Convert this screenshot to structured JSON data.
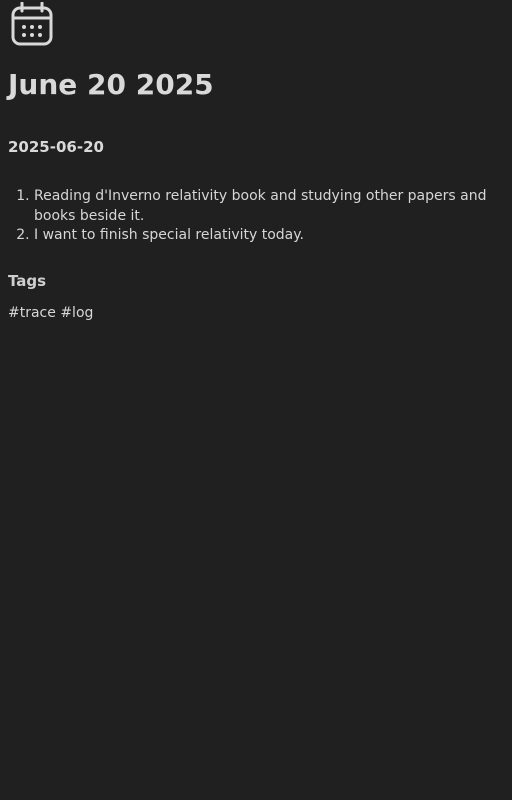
{
  "header": {
    "icon": "calendar-icon",
    "title": "June 20 2025"
  },
  "entry": {
    "date_heading": "2025-06-20",
    "items": [
      "Reading d'Inverno relativity book and studying other papers and books beside it.",
      "I want to finish special relativity today."
    ]
  },
  "tags": {
    "heading": "Tags",
    "items": [
      "#trace",
      "#log"
    ]
  }
}
